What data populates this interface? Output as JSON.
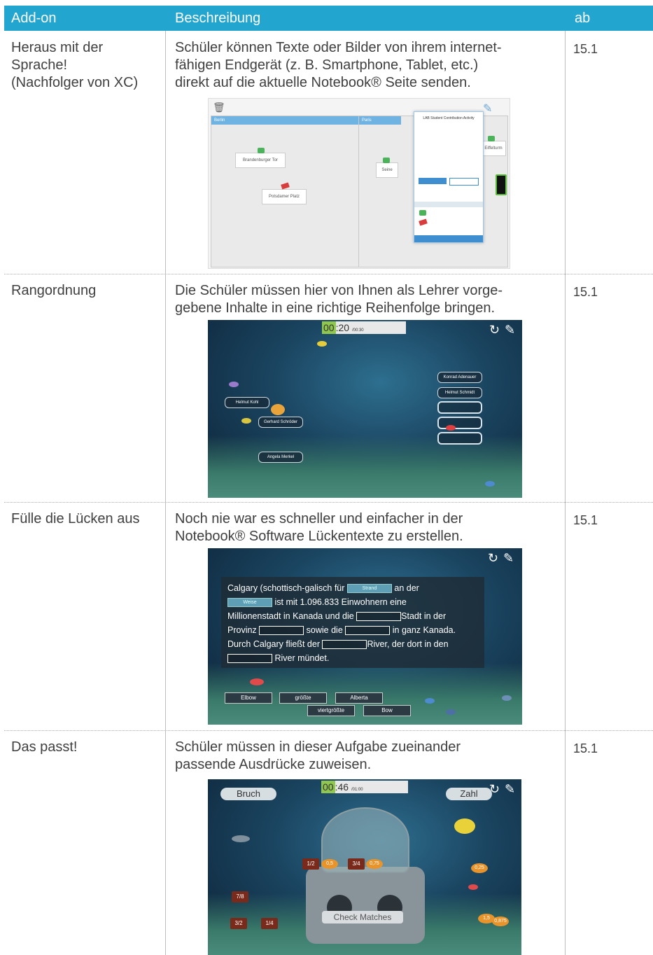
{
  "header": {
    "col1": "Add-on",
    "col2": "Beschreibung",
    "col3": "ab"
  },
  "rows": [
    {
      "name": "Heraus mit der Sprache! (Nachfolger von XC)",
      "name_lines": [
        "Heraus mit der",
        "Sprache!",
        "(Nachfolger von XC)"
      ],
      "desc_lines": [
        "Schüler können Texte oder Bilder von ihrem internet-",
        "fähigen Endgerät (z. B. Smartphone, Tablet, etc.)",
        "direkt auf die aktuelle Notebook® Seite senden."
      ],
      "version": "15.1",
      "shot": {
        "pane_left": "Berlin",
        "pane_right": "Paris",
        "cards": [
          "Brandenburger Tor",
          "Potsdamer Platz",
          "Seine",
          "Eiffelturm"
        ],
        "dialog_title": "LAB Student Contribution Activity"
      }
    },
    {
      "name": "Rangordnung",
      "desc_lines": [
        "Die Schüler müssen hier von Ihnen als Lehrer vorge-",
        "gebene Inhalte in eine richtige Reihenfolge bringen."
      ],
      "version": "15.1",
      "shot": {
        "timer_min": "00",
        "timer_sec": ":20",
        "timer_total": "/00:30",
        "left_items": [
          "Helmut Kohl",
          "Gerhard Schröder",
          "Angela Merkel"
        ],
        "right_items": [
          "Konrad Adenauer",
          "Helmut Schmidt"
        ]
      }
    },
    {
      "name": "Fülle die Lücken aus",
      "desc_lines": [
        "Noch nie war es schneller und einfacher in der",
        "Notebook® Software Lückentexte zu erstellen."
      ],
      "version": "15.1",
      "shot": {
        "t1": "Calgary (schottisch-galisch für",
        "g1": "Strand",
        "t2": "an der",
        "g2": "Weise",
        "t3": "ist mit 1.096.833 Einwohnern eine",
        "t4": "Millionenstadt in Kanada und die",
        "t5": "Stadt in der",
        "t6": "Provinz",
        "t7": "sowie die",
        "t8": "in ganz Kanada.",
        "t9": "Durch Calgary fließt der",
        "t10": "River, der dort in den",
        "t11": "River mündet.",
        "chips": [
          "Elbow",
          "größte",
          "Alberta",
          "viertgrößte",
          "Bow"
        ]
      }
    },
    {
      "name": "Das passt!",
      "desc_lines": [
        "Schüler müssen in dieser Aufgabe zueinander",
        "passende Ausdrücke zuweisen."
      ],
      "version": "15.1",
      "shot": {
        "left_label": "Bruch",
        "right_label": "Zahl",
        "timer_min": "00",
        "timer_sec": ":46",
        "timer_total": "/01:00",
        "fractions": [
          "1/2",
          "0,5",
          "3/4",
          "0,75",
          "7/8",
          "3/2",
          "1/4",
          "1,5",
          "0,25",
          "0,875"
        ],
        "button": "Check Matches"
      }
    }
  ],
  "colors": {
    "header_bg": "#22a5cf",
    "header_text": "#ffffff",
    "text": "#3f3f3f"
  }
}
